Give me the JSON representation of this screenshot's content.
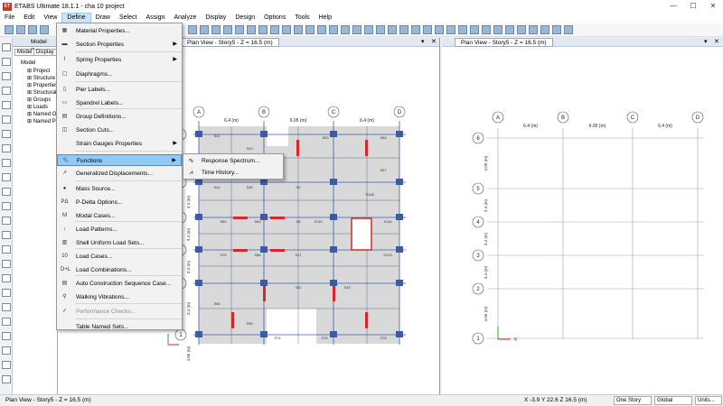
{
  "app": {
    "title": "ETABS Ultimate 18.1.1 - cha 10 project",
    "logo_text": "ET",
    "window_buttons": [
      "—",
      "☐",
      "✕"
    ]
  },
  "menubar": [
    "File",
    "Edit",
    "View",
    "Define",
    "Draw",
    "Select",
    "Assign",
    "Analyze",
    "Display",
    "Design",
    "Options",
    "Tools",
    "Help"
  ],
  "explorer": {
    "title": "Model Exp",
    "tabs": [
      "Model",
      "Display"
    ],
    "tree": [
      "Model",
      "Project",
      "Structure",
      "Properties",
      "Structural",
      "Groups",
      "Loads",
      "Named O",
      "Named Pl"
    ]
  },
  "views": {
    "left_title": "Plan View - Story5 - Z = 16.5 (m)",
    "right_title": "Plan View - Story5 - Z = 16.5 (m)",
    "close_glyphs": [
      "▾",
      "✕"
    ]
  },
  "define_menu": {
    "items": [
      {
        "label": "Material Properties...",
        "icon": "material-icon"
      },
      {
        "label": "Section Properties",
        "icon": "section-icon",
        "submenu": true
      },
      {
        "label": "Spring Properties",
        "icon": "spring-icon",
        "submenu": true
      },
      {
        "label": "Diaphragms...",
        "icon": "diaphragm-icon"
      },
      {
        "label": "Pier Labels...",
        "icon": "pier-icon"
      },
      {
        "label": "Spandrel Labels...",
        "icon": "spandrel-icon"
      },
      {
        "label": "Group Definitions...",
        "icon": "group-icon"
      },
      {
        "label": "Section Cuts...",
        "icon": "section-cut-icon"
      },
      {
        "label": "Strain Gauges Properties",
        "icon": "",
        "submenu": true
      },
      {
        "label": "Functions",
        "icon": "functions-icon",
        "submenu": true,
        "highlighted": true
      },
      {
        "label": "Generalized Displacements...",
        "icon": "displacement-icon"
      },
      {
        "label": "Mass Source...",
        "icon": "mass-icon"
      },
      {
        "label": "P-Delta Options...",
        "icon": "pdelta-icon"
      },
      {
        "label": "Modal Cases...",
        "icon": "modal-icon"
      },
      {
        "label": "Load Patterns...",
        "icon": "load-pattern-icon"
      },
      {
        "label": "Shell Uniform Load Sets...",
        "icon": "shell-load-icon"
      },
      {
        "label": "Load Cases...",
        "icon": "load-case-icon"
      },
      {
        "label": "Load Combinations...",
        "icon": "load-combo-icon"
      },
      {
        "label": "Auto Construction Sequence Case...",
        "icon": "construction-icon"
      },
      {
        "label": "Walking Vibrations...",
        "icon": "walking-icon"
      },
      {
        "label": "Performance Checks...",
        "icon": "performance-icon",
        "disabled": true
      },
      {
        "label": "Table Named Sets...",
        "icon": ""
      }
    ],
    "icon_glyphs": {
      "material-icon": "▦",
      "section-icon": "▬",
      "spring-icon": "⌇",
      "diaphragm-icon": "▢",
      "pier-icon": "▯",
      "spandrel-icon": "▭",
      "group-icon": "▤",
      "section-cut-icon": "◫",
      "functions-icon": "⁰⁄₀",
      "displacement-icon": "↗",
      "mass-icon": "●",
      "pdelta-icon": "PΔ",
      "modal-icon": "M",
      "load-pattern-icon": "↓",
      "shell-load-icon": "▥",
      "load-case-icon": "10",
      "load-combo-icon": "D+L",
      "construction-icon": "▤",
      "walking-icon": "⚲",
      "performance-icon": "✓"
    }
  },
  "functions_submenu": [
    {
      "label": "Response Spectrum...",
      "icon": "spectrum-icon",
      "glyph": "∿"
    },
    {
      "label": "Time History...",
      "icon": "time-history-icon",
      "glyph": "⩘"
    }
  ],
  "plan_left": {
    "grid_x_labels": [
      "A",
      "B",
      "C",
      "D"
    ],
    "grid_y_labels": [
      "6",
      "5",
      "4",
      "3",
      "2",
      "1"
    ],
    "x_dims": [
      "6.4 (m)",
      "6.05 (m)",
      "6.4 (m)"
    ],
    "y_dims": [
      "3.4 (m)",
      "3.4 (m)",
      "3.4 (m)",
      "3.4 (m)",
      "4.05 (m)"
    ],
    "slab_labels": [
      "S41",
      "S43",
      "S52",
      "S54",
      "S57",
      "S44",
      "S45",
      "S9",
      "S108",
      "S64",
      "S65",
      "S8",
      "S119",
      "S116",
      "S75",
      "S86",
      "S17",
      "S123",
      "S32",
      "S33",
      "S66",
      "S95",
      "S74",
      "S76",
      "S78"
    ]
  },
  "plan_right": {
    "grid_x_labels": [
      "A",
      "B",
      "C",
      "D"
    ],
    "grid_y_labels": [
      "6",
      "5",
      "4",
      "3",
      "2",
      "1"
    ],
    "x_dims": [
      "6.4 (m)",
      "6.05 (m)",
      "6.4 (m)"
    ],
    "y_dims": [
      "4.05 (m)",
      "3.4 (m)",
      "3.4 (m)",
      "3.4 (m)",
      "4.05 (m)"
    ]
  },
  "status": {
    "left": "Plan View - Story5 - Z = 16.5 (m)",
    "coords": "X -3.9  Y 22.6  Z 16.5 (m)",
    "story_select": "One Story",
    "coord_select": "Global",
    "units_button": "Units..."
  },
  "colors": {
    "accent": "#3d90d4",
    "menu_highlight": "#91c9f7",
    "beam_red": "#d62828",
    "column_blue": "#3b5ba9",
    "slab_fill": "#d9d9d9"
  }
}
